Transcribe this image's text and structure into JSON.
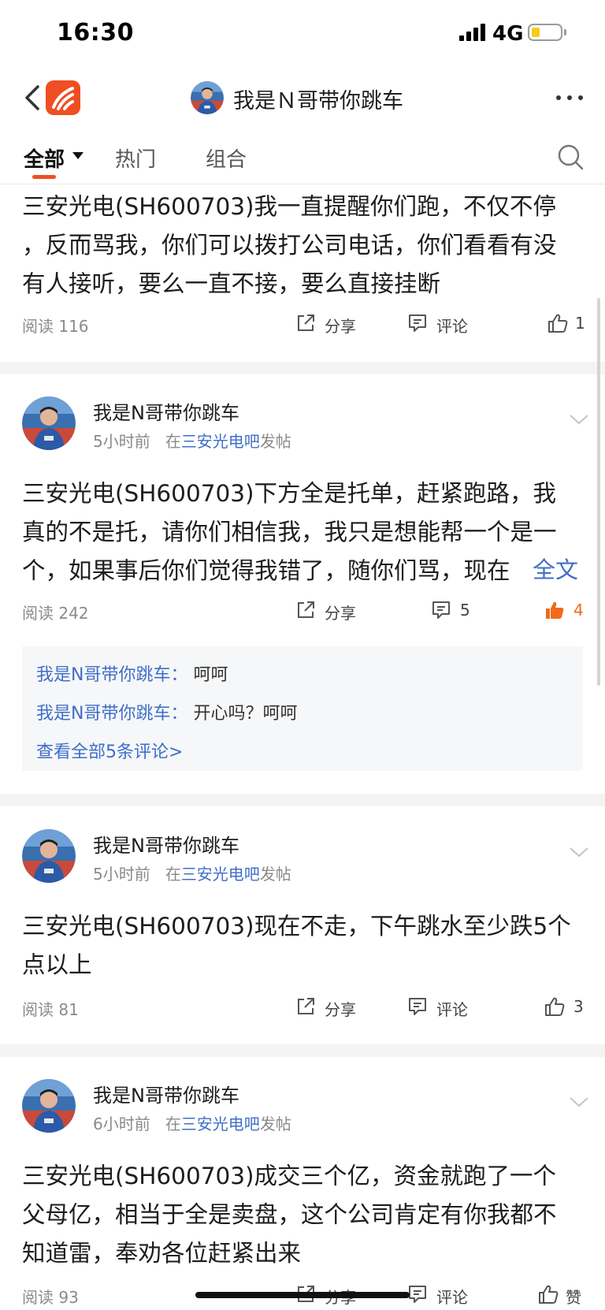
{
  "status": {
    "time": "16:30",
    "network": "4G"
  },
  "nav": {
    "title": "我是Ｎ哥带你跳车"
  },
  "tabs": {
    "all": "全部",
    "hot": "热门",
    "combo": "组合"
  },
  "colors": {
    "accent": "#f04e23",
    "link": "#3f6ec8",
    "liked": "#f06a1e"
  },
  "posts": [
    {
      "text": [
        "三安光电(SH600703)我一直提醒你们跑，不仅不停",
        "，反而骂我，你们可以拨打公司电话，你们看看有没",
        "有人接听，要么一直不接，要么直接挂断"
      ],
      "reads": "阅读 116",
      "share": "分享",
      "comment": "评论",
      "likes": "1"
    },
    {
      "author": "我是N哥带你跳车",
      "time": "5小时前",
      "in": "在",
      "bar": "三安光电吧",
      "post": "发帖",
      "text": [
        "三安光电(SH600703)下方全是托单，赶紧跑路，我",
        "真的不是托，请你们相信我，我只是想能帮一个是一",
        "个，如果事后你们觉得我错了，随你们骂，现在"
      ],
      "full_text": "全文",
      "reads": "阅读 242",
      "share": "分享",
      "comment": "5",
      "likes": "4",
      "replies": [
        {
          "name": "我是N哥带你跳车：",
          "text": "呵呵"
        },
        {
          "name": "我是N哥带你跳车：",
          "text": "开心吗？呵呵"
        }
      ],
      "view_all": "查看全部5条评论>"
    },
    {
      "author": "我是N哥带你跳车",
      "time": "5小时前",
      "in": "在",
      "bar": "三安光电吧",
      "post": "发帖",
      "text": [
        "三安光电(SH600703)现在不走，下午跳水至少跌5个",
        "点以上"
      ],
      "reads": "阅读 81",
      "share": "分享",
      "comment": "评论",
      "likes": "3"
    },
    {
      "author": "我是N哥带你跳车",
      "time": "6小时前",
      "in": "在",
      "bar": "三安光电吧",
      "post": "发帖",
      "text": [
        "三安光电(SH600703)成交三个亿，资金就跑了一个",
        "父母亿，相当于全是卖盘，这个公司肯定有你我都不",
        "知道雷，奉劝各位赶紧出来"
      ],
      "reads": "阅读 93",
      "share": "分享",
      "comment": "评论",
      "likes": "赞"
    }
  ]
}
